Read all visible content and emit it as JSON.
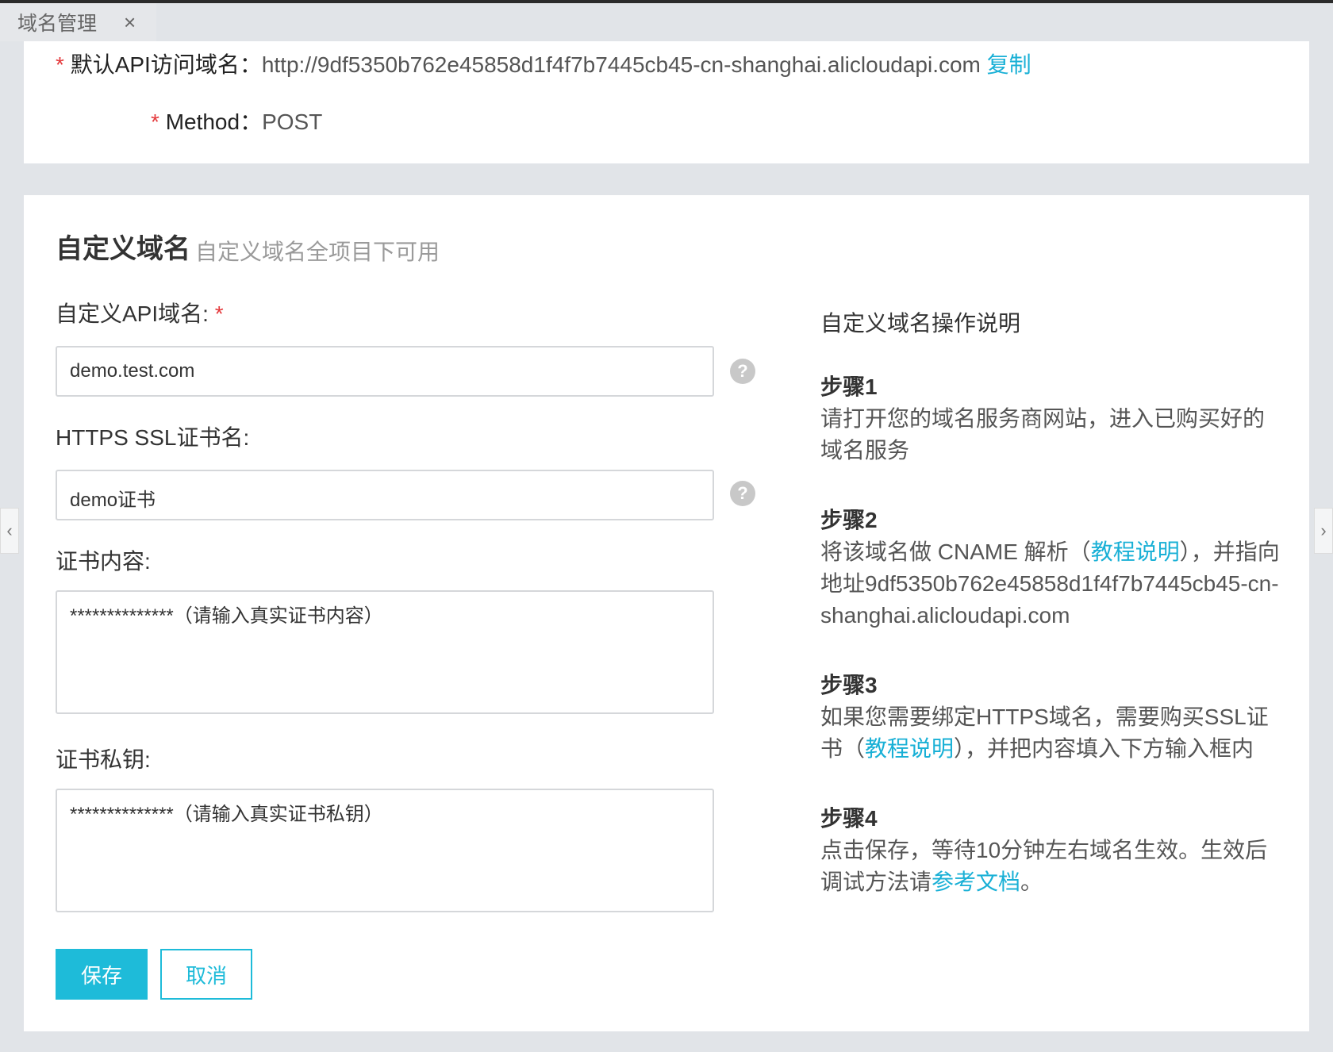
{
  "tab": {
    "label": "域名管理",
    "close": "×"
  },
  "default_api": {
    "required_mark": "*",
    "label": "默认API访问域名：",
    "value": "http://9df5350b762e45858d1f4f7b7445cb45-cn-shanghai.alicloudapi.com",
    "copy_label": "复制"
  },
  "method": {
    "required_mark": "*",
    "label": "Method：",
    "value": "POST"
  },
  "custom_domain": {
    "title": "自定义域名",
    "subtitle": "自定义域名全项目下可用",
    "api_domain": {
      "label": "自定义API域名:",
      "required_mark": "*",
      "value": "demo.test.com"
    },
    "ssl_name": {
      "label": "HTTPS SSL证书名:",
      "value": "demo证书"
    },
    "cert_content": {
      "label": "证书内容:",
      "value": "**************（请输入真实证书内容）"
    },
    "cert_key": {
      "label": "证书私钥:",
      "value": "**************（请输入真实证书私钥）"
    },
    "help_icon": "?",
    "save_label": "保存",
    "cancel_label": "取消"
  },
  "guide": {
    "title": "自定义域名操作说明",
    "step1": {
      "title": "步骤1",
      "text": "请打开您的域名服务商网站，进入已购买好的域名服务"
    },
    "step2": {
      "title": "步骤2",
      "text_before": "将该域名做 CNAME 解析（",
      "link": "教程说明",
      "text_after": "），并指向地址9df5350b762e45858d1f4f7b7445cb45-cn-shanghai.alicloudapi.com"
    },
    "step3": {
      "title": "步骤3",
      "text_before": "如果您需要绑定HTTPS域名，需要购买SSL证书（",
      "link": "教程说明",
      "text_after": "），并把内容填入下方输入框内"
    },
    "step4": {
      "title": "步骤4",
      "text_before": "点击保存，等待10分钟左右域名生效。生效后调试方法请",
      "link": "参考文档",
      "text_after": "。"
    }
  },
  "nav": {
    "left": "‹",
    "right": "›"
  },
  "colors": {
    "accent": "#1ebbd9",
    "required": "#e4393c",
    "background": "#e1e4e8"
  }
}
